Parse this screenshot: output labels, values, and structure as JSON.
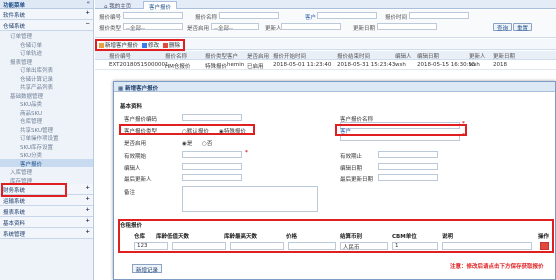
{
  "sidebar": {
    "title": "功能菜单",
    "collapse": "«",
    "sections": [
      {
        "label": "软件系统",
        "pm": "+"
      },
      {
        "label": "仓储系统",
        "pm": "−"
      }
    ],
    "items": [
      "订单管理",
      "仓储订单",
      "订单轨迹",
      "报表管理",
      "订单出库列表",
      "仓储计算记录",
      "共享产品列表",
      "基础数据管理",
      "SKU品类",
      "商品SKU",
      "仓库管理",
      "共享SKU管理",
      "订单操作项设置",
      "SKU库存设置",
      "SKU分类",
      "客户报价",
      "入库管理",
      "库存管理"
    ],
    "bottom": [
      {
        "label": "财务系统",
        "pm": "+"
      },
      {
        "label": "运输系统",
        "pm": "+"
      },
      {
        "label": "报表系统",
        "pm": "+"
      },
      {
        "label": "基本资料",
        "pm": "+"
      },
      {
        "label": "系统管理",
        "pm": "+"
      }
    ]
  },
  "tabs": {
    "home": "我的主页",
    "active": "客户报价"
  },
  "filters": {
    "l1": "报价编号",
    "l2": "报价名称",
    "l3": "客户",
    "l4": "报价时间",
    "l5": "报价类型",
    "v5": "--全部--",
    "l6": "是否启用",
    "v6": "--全部--",
    "l7": "更新人",
    "l8": "更新日期",
    "query": "查询",
    "reset": "重置"
  },
  "toolbar": {
    "add": "新增客户报价",
    "edit": "修改",
    "del": "删除"
  },
  "grid": {
    "headers": [
      "报价编号",
      "报价名称",
      "报价类型",
      "客户",
      "是否启用",
      "报价开始时间",
      "报价结束时间",
      "编辑人",
      "编辑日期",
      "更新人",
      "更新日期"
    ],
    "row": [
      "EXT20180515000001",
      "HM仓报价",
      "特殊报价",
      "hemin",
      "已启用",
      "2018-05-01 11:23:40",
      "2018-05-31 15:23:43",
      "wsh",
      "2018-05-15 16:30:55",
      "wsh",
      "2018"
    ]
  },
  "modal": {
    "title": "新增客户报价",
    "basic": "基本资料",
    "code": "客户报价编码",
    "name": "客户报价名称",
    "type": "客户报价类型",
    "type_opt1": "默认报价",
    "type_opt2": "特殊报价",
    "customer": "客户",
    "enabled": "是否启用",
    "yes": "是",
    "no": "否",
    "start": "有效期始",
    "end": "有效期止",
    "editor": "编辑人",
    "edit_date": "编辑日期",
    "updater": "最后更新人",
    "update_date": "最后更新日期",
    "remark": "备注",
    "price_sec": "仓租报价",
    "cols": [
      "仓库",
      "库龄低值天数",
      "库龄最高天数",
      "价格",
      "结算币别",
      "CBM单位",
      "说明",
      "操作"
    ],
    "row": {
      "wh": "123",
      "cur": "人民币",
      "cbm": "1"
    },
    "note": "注意：修改后请点击下方保存获取报价",
    "add_row": "新增记录"
  }
}
